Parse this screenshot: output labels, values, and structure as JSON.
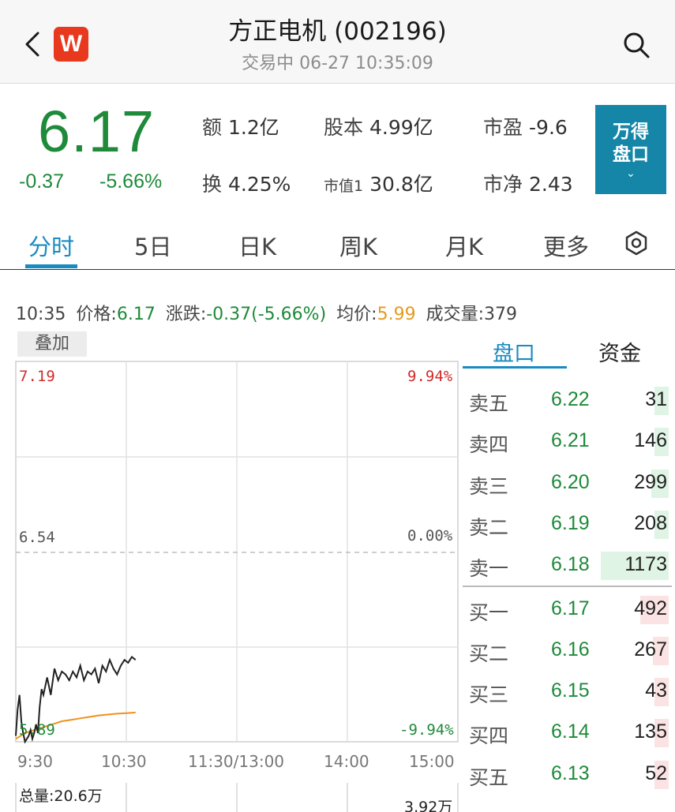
{
  "header": {
    "logo_text": "W",
    "title": "方正电机 (002196)",
    "status": "交易中 06-27 10:35:09",
    "icons": {
      "back": "chevron-left-icon",
      "search": "search-icon"
    }
  },
  "quote": {
    "price": "6.17",
    "change": "-0.37",
    "change_pct": "-5.66%",
    "stats": [
      {
        "label": "额",
        "value": "1.2亿"
      },
      {
        "label": "股本",
        "value": "4.99亿"
      },
      {
        "label": "市盈",
        "value": "-9.6"
      },
      {
        "label": "换",
        "value": "4.25%"
      },
      {
        "label": "市值1",
        "value": "30.8亿"
      },
      {
        "label": "市净",
        "value": "2.43"
      }
    ],
    "wind_button": {
      "line1": "万得",
      "line2": "盘口",
      "chevron": "⌄"
    }
  },
  "tabs": [
    "分时",
    "5日",
    "日K",
    "周K",
    "月K",
    "更多"
  ],
  "active_tab": "分时",
  "info": {
    "time": "10:35",
    "price_label": "价格:",
    "price": "6.17",
    "chg_label": "涨跌:",
    "chg": "-0.37(-5.66%)",
    "avg_label": "均价:",
    "avg": "5.99",
    "vol_label": "成交量:",
    "vol": "379"
  },
  "chart": {
    "overlay_label": "叠加",
    "y_left": {
      "top": "7.19",
      "mid": "6.54",
      "bottom": "5.89"
    },
    "y_right": {
      "top": "9.94%",
      "mid": "0.00%",
      "bottom": "-9.94%"
    },
    "x_labels": [
      "9:30",
      "10:30",
      "11:30/13:00",
      "14:00",
      "15:00"
    ],
    "total_vol": "总量:20.6万",
    "vol_max": "3.92万",
    "colors": {
      "price_line": "#222222",
      "avg_line": "#f0901e",
      "up": "#d22b2b",
      "down": "#1e8a3a"
    }
  },
  "chart_data": {
    "type": "line",
    "x_range": [
      "9:30",
      "15:00"
    ],
    "ylim": [
      5.89,
      7.19
    ],
    "pre_close": 6.54,
    "series": [
      {
        "x": [
          "9:30",
          "9:31",
          "9:32",
          "9:33",
          "9:34",
          "9:35",
          "9:36",
          "9:37",
          "9:38",
          "9:39",
          "9:40",
          "9:41",
          "9:42",
          "9:43",
          "9:44",
          "9:45",
          "9:47",
          "9:49",
          "9:51",
          "9:53",
          "9:55",
          "9:57",
          "9:59",
          "10:01",
          "10:03",
          "10:05",
          "10:07",
          "10:09",
          "10:11",
          "10:13",
          "10:15",
          "10:17",
          "10:19",
          "10:21",
          "10:23",
          "10:25",
          "10:27",
          "10:29",
          "10:31",
          "10:33",
          "10:35"
        ],
        "values": [
          5.91,
          6.0,
          6.05,
          5.96,
          5.92,
          5.89,
          5.9,
          5.91,
          5.93,
          5.9,
          5.92,
          5.95,
          5.92,
          6.01,
          6.07,
          6.05,
          6.11,
          6.05,
          6.14,
          6.1,
          6.13,
          6.12,
          6.1,
          6.13,
          6.11,
          6.15,
          6.1,
          6.13,
          6.12,
          6.14,
          6.09,
          6.15,
          6.13,
          6.17,
          6.14,
          6.12,
          6.15,
          6.17,
          6.16,
          6.18,
          6.17
        ]
      },
      {
        "x": [
          "9:30",
          "9:35",
          "9:40",
          "9:45",
          "9:50",
          "9:55",
          "10:00",
          "10:05",
          "10:10",
          "10:15",
          "10:20",
          "10:25",
          "10:30",
          "10:35"
        ],
        "values": [
          5.9,
          5.92,
          5.93,
          5.94,
          5.95,
          5.96,
          5.965,
          5.97,
          5.975,
          5.98,
          5.983,
          5.986,
          5.988,
          5.99
        ]
      }
    ]
  },
  "orderbook": {
    "tabs": [
      "盘口",
      "资金"
    ],
    "sell": [
      {
        "name": "卖五",
        "price": "6.22",
        "qty": "31",
        "qty_num": 31
      },
      {
        "name": "卖四",
        "price": "6.21",
        "qty": "146",
        "qty_num": 146
      },
      {
        "name": "卖三",
        "price": "6.20",
        "qty": "299",
        "qty_num": 299
      },
      {
        "name": "卖二",
        "price": "6.19",
        "qty": "208",
        "qty_num": 208
      },
      {
        "name": "卖一",
        "price": "6.18",
        "qty": "1173",
        "qty_num": 1173
      }
    ],
    "buy": [
      {
        "name": "买一",
        "price": "6.17",
        "qty": "492",
        "qty_num": 492
      },
      {
        "name": "买二",
        "price": "6.16",
        "qty": "267",
        "qty_num": 267
      },
      {
        "name": "买三",
        "price": "6.15",
        "qty": "43",
        "qty_num": 43
      },
      {
        "name": "买四",
        "price": "6.14",
        "qty": "135",
        "qty_num": 135
      },
      {
        "name": "买五",
        "price": "6.13",
        "qty": "52",
        "qty_num": 52
      }
    ]
  }
}
